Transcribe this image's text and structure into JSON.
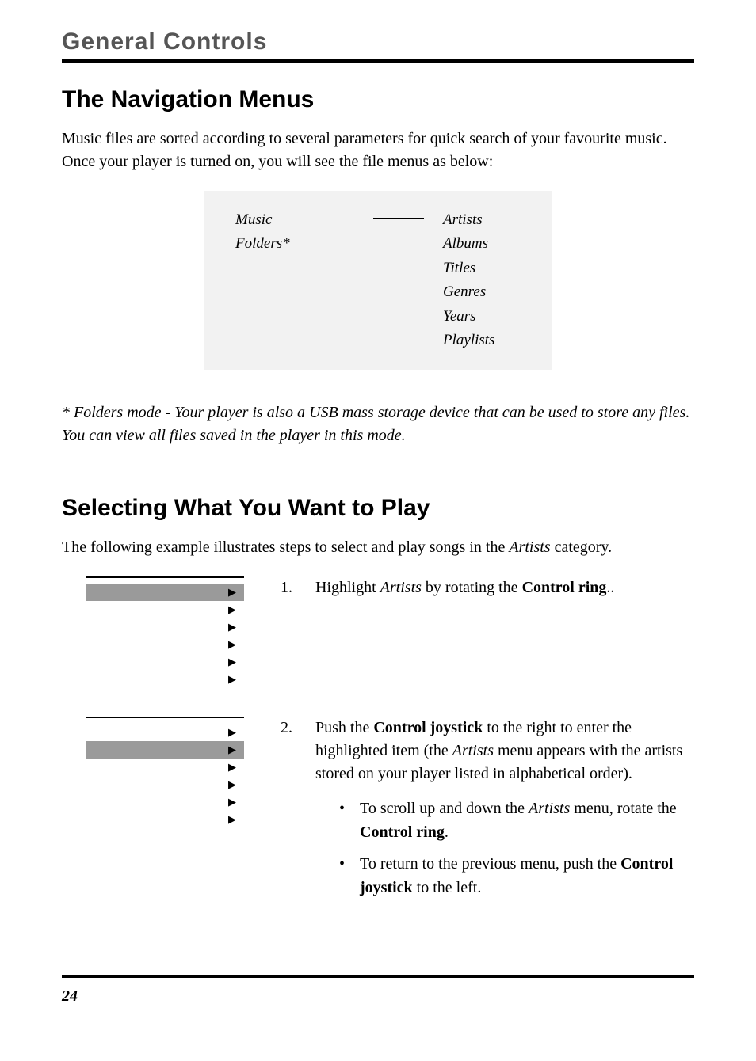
{
  "header": {
    "section_title": "General Controls"
  },
  "nav_menus": {
    "title": "The Navigation Menus",
    "intro": "Music files are sorted according to several parameters for quick search of your favourite music. Once your player is turned on, you will see the file menus as below:",
    "left_items": [
      "Music",
      "Folders*"
    ],
    "right_items": [
      "Artists",
      "Albums",
      "Titles",
      "Genres",
      "Years",
      "Playlists"
    ],
    "footnote": "* Folders mode - Your player is also a USB mass storage device that can be used to store any files. You can view all files saved in the player in this mode."
  },
  "selecting": {
    "title": "Selecting What You Want to Play",
    "intro_pre": "The following example illustrates steps to select and play songs in the ",
    "intro_em": "Artists",
    "intro_post": " category.",
    "step1": {
      "num": "1.",
      "pre": "Highlight ",
      "em": "Artists",
      "mid": " by rotating the ",
      "strong": "Control ring",
      "post": ".."
    },
    "step2": {
      "num": "2.",
      "pre": "Push the ",
      "strong1": "Control joystick",
      "mid1": " to the right to enter the highlighted item (the ",
      "em1": "Artists",
      "mid2": " menu appears with the artists stored on your player listed in alphabetical order).",
      "bullet1": {
        "pre": "To scroll up and down the ",
        "em": "Artists",
        "mid": " menu, rotate the ",
        "strong": "Control ring",
        "post": "."
      },
      "bullet2": {
        "pre": "To return to the previous menu, push the ",
        "strong": "Control joystick",
        "post": " to the left."
      }
    }
  },
  "footer": {
    "page_number": "24"
  },
  "glyphs": {
    "triangle": "▶",
    "bullet": "•"
  }
}
